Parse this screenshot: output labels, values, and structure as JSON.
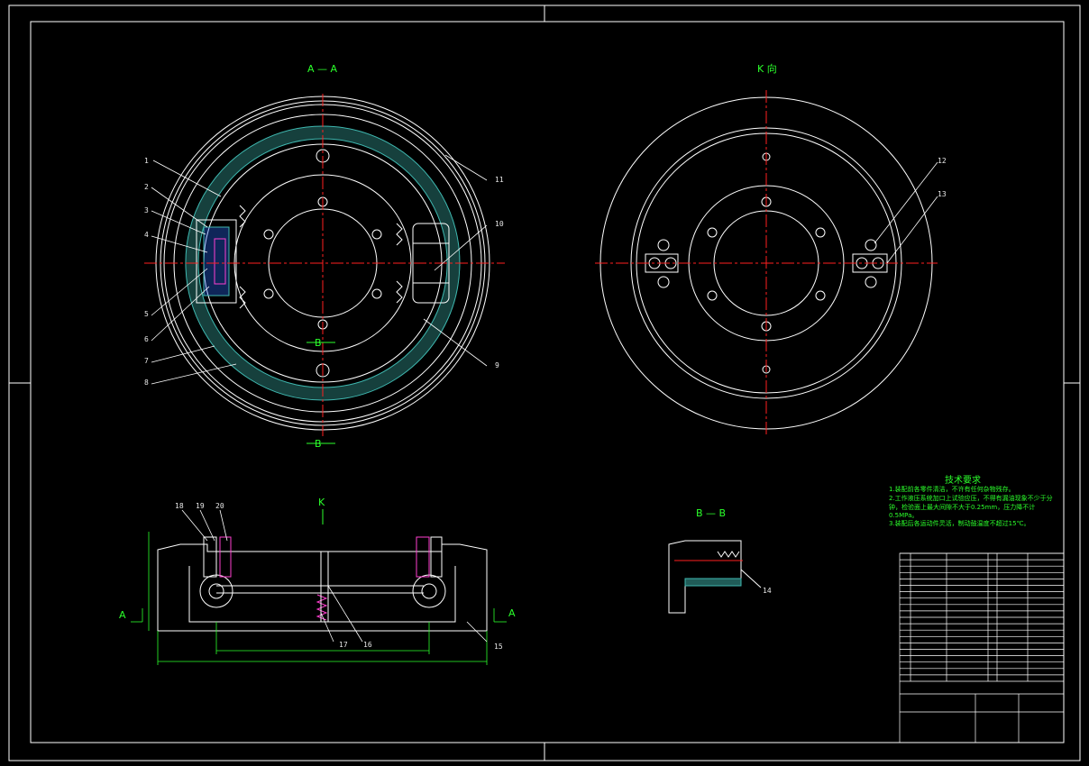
{
  "drawing": {
    "view_labels": {
      "section_aa": "A — A",
      "view_k": "K 向",
      "section_bb": "B — B"
    },
    "section_markers": {
      "b_top": "B",
      "b_bottom": "B",
      "a_left": "A",
      "a_right": "A",
      "k_mark": "K"
    },
    "part_numbers": [
      "1",
      "2",
      "3",
      "4",
      "5",
      "6",
      "7",
      "8",
      "9",
      "10",
      "11",
      "12",
      "13",
      "14",
      "15",
      "16",
      "17",
      "18",
      "19",
      "20"
    ],
    "tech_requirements": {
      "title": "技术要求",
      "lines": [
        "1.装配前各零件清洁，不许有任何杂物残存。",
        "2.工作液压系统加口上试验应压，不得有漏油现象不少于分",
        "  钟，检验面上最大间隙不大于0.25mm，压力降不计",
        "  0.5MPa。",
        "3.装配后各运动件灵活，制动鼓温度不超过15℃。"
      ]
    },
    "colors": {
      "background": "#000000",
      "outline": "#ffffff",
      "centerline": "#ff2020",
      "dimension": "#2bff2b",
      "hatch": "#3fb8b0",
      "accent": "#ff3fd0"
    }
  }
}
